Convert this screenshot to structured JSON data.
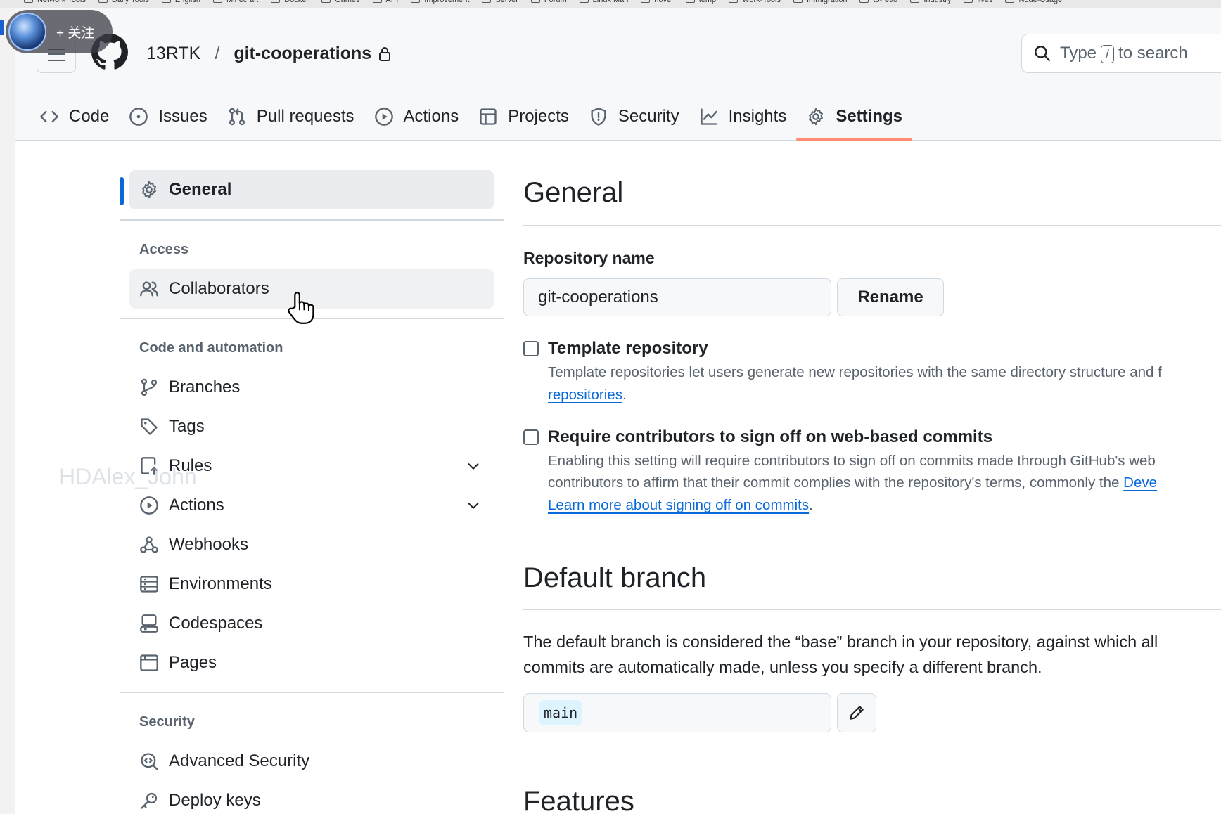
{
  "bookmarks": [
    "Network Tools",
    "Daily Tools",
    "English",
    "Minecraft",
    "Docker",
    "Games",
    "API",
    "Improvement",
    "Server",
    "Forum",
    "Linux Man",
    "novel",
    "temp",
    "Work-Tools",
    "Immigration",
    "to-read",
    "Industry",
    "lives",
    "Node-Usage"
  ],
  "overlay": {
    "follow_label": "+ 关注",
    "watermark": "HDAlex_John"
  },
  "header": {
    "owner": "13RTK",
    "separator": "/",
    "repo": "git-cooperations",
    "search": {
      "prefix": "Type",
      "key": "/",
      "suffix": "to search"
    }
  },
  "tabs": [
    {
      "label": "Code",
      "icon": "code-icon"
    },
    {
      "label": "Issues",
      "icon": "issue-opened-icon"
    },
    {
      "label": "Pull requests",
      "icon": "git-pull-request-icon"
    },
    {
      "label": "Actions",
      "icon": "play-icon"
    },
    {
      "label": "Projects",
      "icon": "table-icon"
    },
    {
      "label": "Security",
      "icon": "shield-icon"
    },
    {
      "label": "Insights",
      "icon": "graph-icon"
    },
    {
      "label": "Settings",
      "icon": "gear-icon",
      "active": true
    }
  ],
  "sidebar": {
    "general": "General",
    "access_heading": "Access",
    "collaborators": "Collaborators",
    "code_heading": "Code and automation",
    "code_items": [
      "Branches",
      "Tags",
      "Rules",
      "Actions",
      "Webhooks",
      "Environments",
      "Codespaces",
      "Pages"
    ],
    "security_heading": "Security",
    "security_items": [
      "Advanced Security",
      "Deploy keys"
    ]
  },
  "main": {
    "title": "General",
    "repo_name_label": "Repository name",
    "repo_name_value": "git-cooperations",
    "rename_label": "Rename",
    "template": {
      "title": "Template repository",
      "desc_line1": "Template repositories let users generate new repositories with the same directory structure and f",
      "desc_link": "repositories",
      "desc_end": "."
    },
    "signoff": {
      "title": "Require contributors to sign off on web-based commits",
      "desc_line1": "Enabling this setting will require contributors to sign off on commits made through GitHub's web",
      "desc_line2": "contributors to affirm that their commit complies with the repository's terms, commonly the",
      "desc_line2_link": "Deve",
      "learn_more": "Learn more about signing off on commits",
      "learn_more_end": "."
    },
    "default_branch": {
      "title": "Default branch",
      "desc_line1": "The default branch is considered the “base” branch in your repository, against which all",
      "desc_line2": "commits are automatically made, unless you specify a different branch.",
      "branch": "main"
    },
    "features_title": "Features"
  }
}
